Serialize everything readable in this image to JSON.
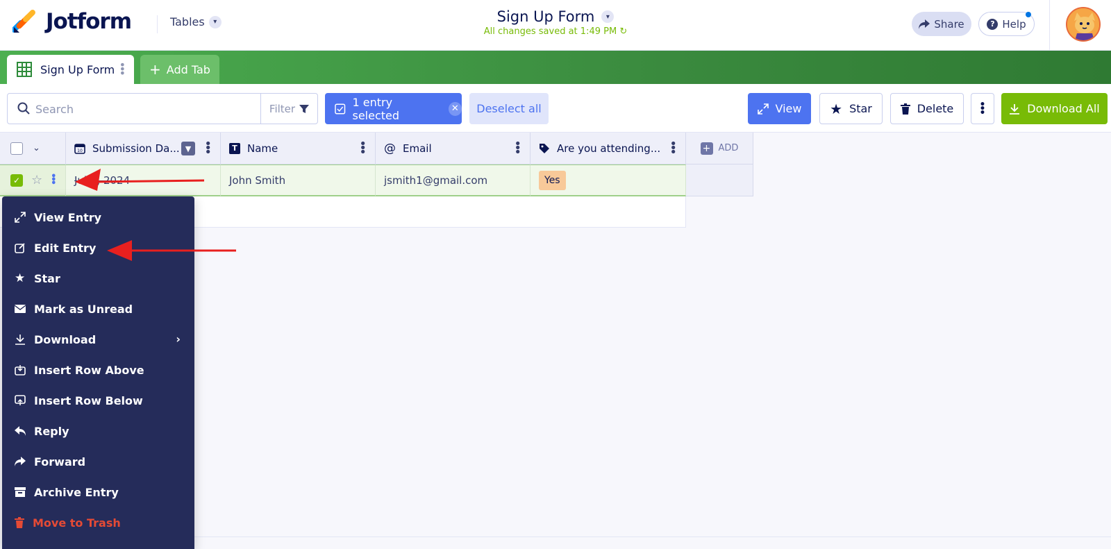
{
  "header": {
    "logo_text": "Jotform",
    "tables_label": "Tables",
    "form_title": "Sign Up Form",
    "saved_status": "All changes saved at 1:49 PM",
    "share_label": "Share",
    "help_label": "Help",
    "help_badge_color": "#0075e3"
  },
  "tabs": {
    "active_label": "Sign Up Form",
    "add_label": "Add Tab"
  },
  "toolbar": {
    "search_placeholder": "Search",
    "filter_label": "Filter",
    "selected_label": "1 entry selected",
    "deselect_label": "Deselect all",
    "view_label": "View",
    "star_label": "Star",
    "delete_label": "Delete",
    "download_all_label": "Download All"
  },
  "table": {
    "columns": [
      {
        "label": "Submission Da...",
        "icon": "calendar-icon"
      },
      {
        "label": "Name",
        "icon": "text-icon"
      },
      {
        "label": "Email",
        "icon": "at-icon"
      },
      {
        "label": "Are you attending...",
        "icon": "tag-icon"
      }
    ],
    "add_column_label": "ADD",
    "rows": [
      {
        "submission_date": "Jul 3, 2024",
        "name": "John Smith",
        "email": "jsmith1@gmail.com",
        "attending": "Yes"
      }
    ]
  },
  "context_menu": {
    "items": [
      {
        "label": "View Entry",
        "icon": "expand-icon"
      },
      {
        "label": "Edit Entry",
        "icon": "edit-icon"
      },
      {
        "label": "Star",
        "icon": "star-icon"
      },
      {
        "label": "Mark as Unread",
        "icon": "envelope-icon"
      },
      {
        "label": "Download",
        "icon": "download-icon"
      },
      {
        "label": "Insert Row Above",
        "icon": "insert-above-icon"
      },
      {
        "label": "Insert Row Below",
        "icon": "insert-below-icon"
      },
      {
        "label": "Reply",
        "icon": "reply-icon"
      },
      {
        "label": "Forward",
        "icon": "forward-icon"
      },
      {
        "label": "Archive Entry",
        "icon": "archive-icon"
      },
      {
        "label": "Move to Trash",
        "icon": "trash-icon"
      }
    ]
  },
  "colors": {
    "accent_blue": "#4d73f0",
    "green": "#78bb07",
    "menu_bg": "#252c5a",
    "danger": "#e54a35",
    "annotation_red": "#e8201f"
  }
}
